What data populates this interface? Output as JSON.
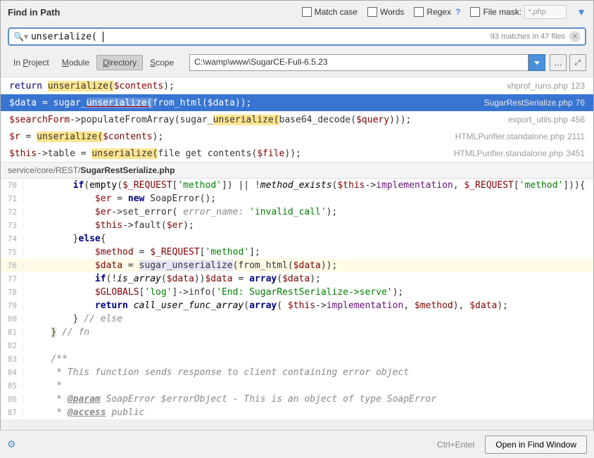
{
  "title": "Find in Path",
  "options": {
    "match_case": "Match case",
    "words": "Words",
    "regex": "Regex",
    "file_mask": "File mask:",
    "file_mask_placeholder": "*.php"
  },
  "search": {
    "query": "unserialize(",
    "matches_text": "93 matches in 47 files"
  },
  "scope": {
    "tabs": [
      "In Project",
      "Module",
      "Directory",
      "Scope"
    ],
    "active": "Directory",
    "path": "C:\\wamp\\www\\SugarCE-Full-6.5.23"
  },
  "results": [
    {
      "pre": "return ",
      "hl": "unserialize(",
      "post": "$contents);",
      "file": "xhprof_runs.php",
      "line": "123",
      "selected": false
    },
    {
      "pre": "$data = sugar_",
      "hl": "unserialize(",
      "post": "from_html($data));",
      "file": "SugarRestSerialize.php",
      "line": "76",
      "selected": true
    },
    {
      "pre": "$searchForm->populateFromArray(sugar_",
      "hl": "unserialize(",
      "post": "base64_decode($query)));",
      "file": "export_utils.php",
      "line": "456",
      "selected": false
    },
    {
      "pre": "$r = ",
      "hl": "unserialize(",
      "post": "$contents);",
      "file": "HTMLPurifier.standalone.php",
      "line": "2111",
      "selected": false
    },
    {
      "pre": "$this->table = ",
      "hl": "unserialize(",
      "post": "file get contents($file));",
      "file": "HTMLPurifier.standalone.php",
      "line": "3451",
      "selected": false
    }
  ],
  "preview": {
    "path_prefix": "service/core/REST/",
    "filename": "SugarRestSerialize.php",
    "lines": [
      {
        "n": "70",
        "html": "        <span class='kw'>if</span>(<span class='fn-call'>empty</span>(<span class='var'>$_REQUEST</span>[<span class='str'>'method'</span>]) || !<span class='fn-call' style='font-style:italic'>method_exists</span>(<span class='var'>$this</span>-&gt;<span style='color:#660e7a'>implementation</span>, <span class='var'>$_REQUEST</span>[<span class='str'>'method'</span>])){"
      },
      {
        "n": "71",
        "html": "            <span class='var'>$er</span> = <span class='kw'>new</span> SoapError();"
      },
      {
        "n": "72",
        "html": "            <span class='var'>$er</span>-&gt;set_error( <span class='param-name'>error_name:</span> <span class='str'>'invalid_call'</span>);"
      },
      {
        "n": "73",
        "html": "            <span class='var'>$this</span>-&gt;fault(<span class='var'>$er</span>);"
      },
      {
        "n": "74",
        "html": "        }<span class='kw'>else</span>{"
      },
      {
        "n": "75",
        "html": "            <span class='var'>$method</span> = <span class='var'>$_REQUEST</span>[<span class='str'>'method'</span>];"
      },
      {
        "n": "76",
        "html": "            <span class='var'>$data</span> = <span style='background:#e6e6fa'>sugar_unserialize</span>(from_html(<span class='var'>$data</span>));",
        "current": true
      },
      {
        "n": "77",
        "html": "            <span class='kw'>if</span>(!<span class='fn-call' style='font-style:italic'>is_array</span>(<span class='var'>$data</span>))<span class='var'>$data</span> = <span class='kw'>array</span>(<span class='var'>$data</span>);"
      },
      {
        "n": "78",
        "html": "            <span class='var'>$GLOBALS</span>[<span class='str'>'log'</span>]-&gt;info(<span class='str'>'End: SugarRestSerialize-&gt;serve'</span>);"
      },
      {
        "n": "79",
        "html": "            <span class='kw'>return</span> <span class='fn-call' style='font-style:italic'>call_user_func_array</span>(<span class='kw'>array</span>( <span class='var'>$this</span>-&gt;<span style='color:#660e7a'>implementation</span>, <span class='var'>$method</span>), <span class='var'>$data</span>);"
      },
      {
        "n": "80",
        "html": "        } <span class='cmt'>// else</span>"
      },
      {
        "n": "81",
        "html": "    <span style='background:#e8f0dc'>}</span> <span class='cmt'>// fn</span>"
      },
      {
        "n": "82",
        "html": ""
      },
      {
        "n": "83",
        "html": "    <span class='cmt'>/**</span>"
      },
      {
        "n": "84",
        "html": "    <span class='cmt'> * This function sends response to client containing error object</span>"
      },
      {
        "n": "85",
        "html": "    <span class='cmt'> *</span>"
      },
      {
        "n": "86",
        "html": "    <span class='cmt'> * <span class='doc-tag'>@param</span> SoapError $errorObject - This is an object of type SoapError</span>"
      },
      {
        "n": "87",
        "html": "    <span class='cmt'> * <span class='doc-tag'>@access</span> public</span>"
      }
    ]
  },
  "statusbar": {
    "shortcut": "Ctrl+Enter",
    "button": "Open in Find Window"
  }
}
